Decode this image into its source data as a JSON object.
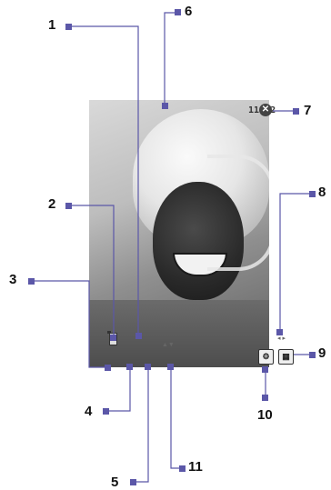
{
  "screen": {
    "clock": "11:02",
    "close_glyph": "✕",
    "left_arrows": "▲▼",
    "right_arrows": "◂ ▸",
    "tools_icon": "tools-icon",
    "grid_icon": "grid-icon"
  },
  "callouts": [
    "1",
    "2",
    "3",
    "4",
    "5",
    "6",
    "7",
    "8",
    "9",
    "10",
    "11"
  ],
  "colors": {
    "leader": "#5b57a8",
    "number": "#111111"
  }
}
